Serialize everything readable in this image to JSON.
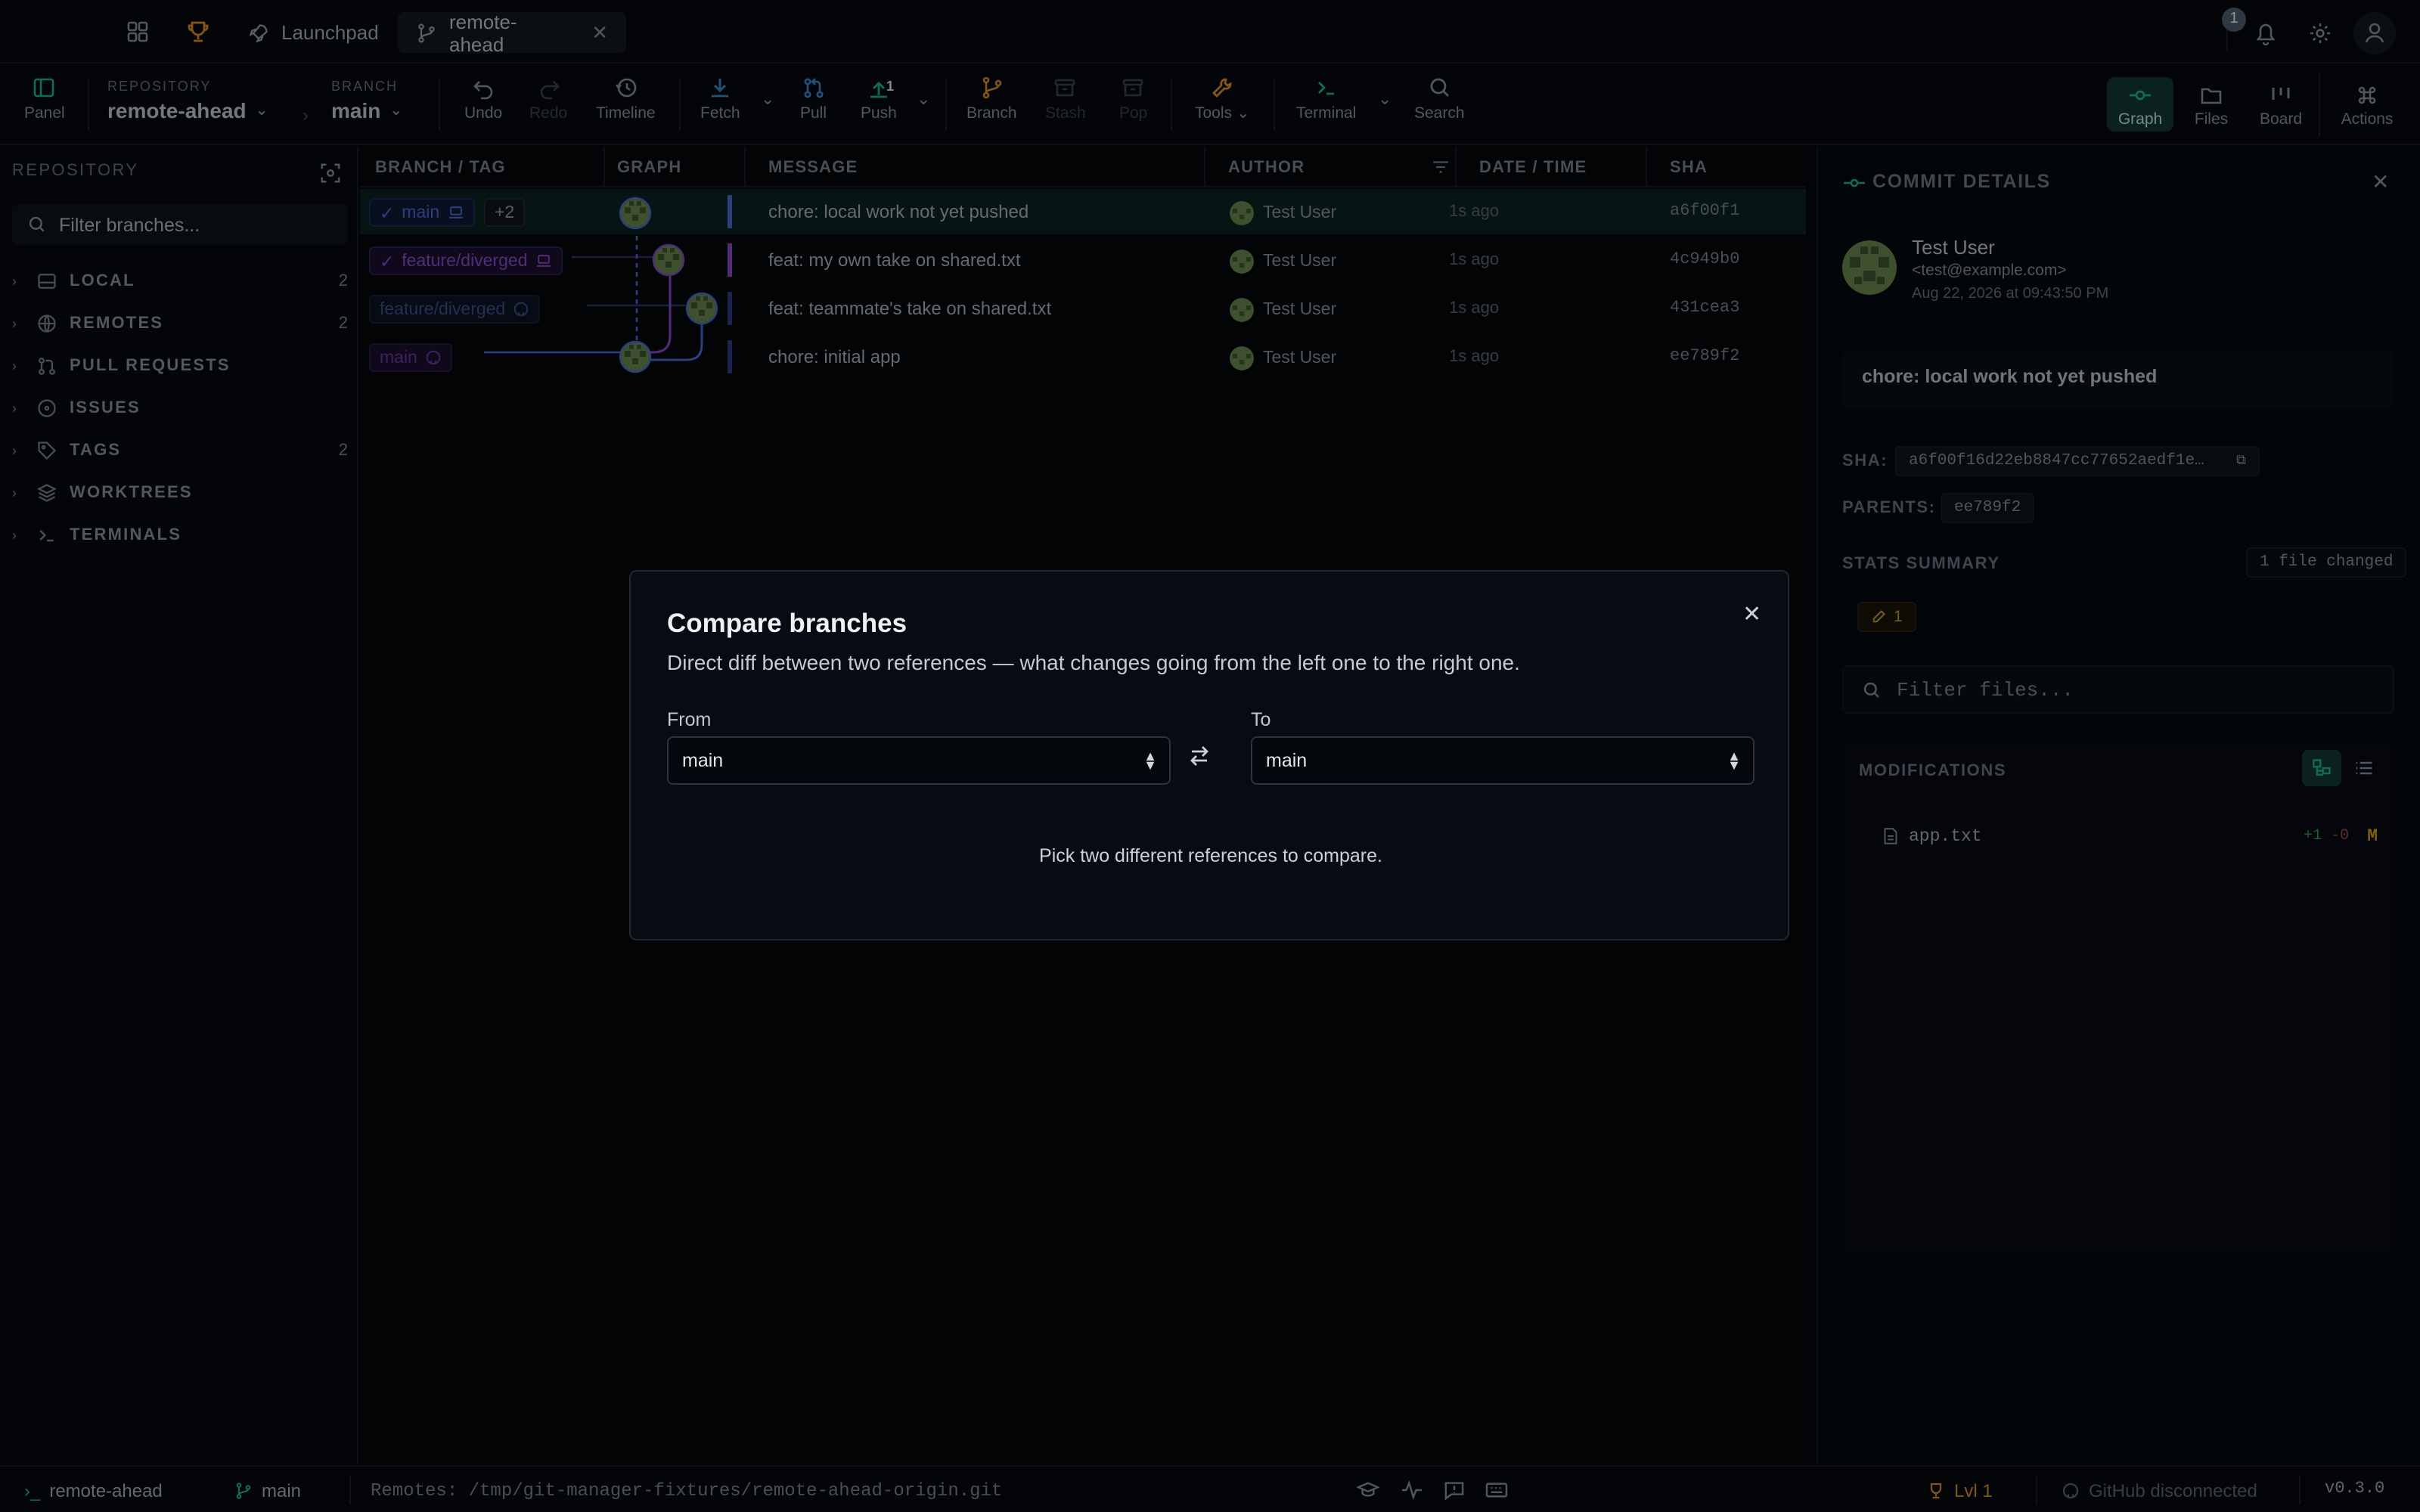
{
  "titlebar": {
    "tabs": [
      {
        "label": "Launchpad",
        "icon": "rocket-icon"
      },
      {
        "label": "remote-ahead",
        "icon": "branch-icon"
      }
    ],
    "notifications_count": "1"
  },
  "toolbar": {
    "panel_label": "Panel",
    "repository_caption": "REPOSITORY",
    "repository_value": "remote-ahead",
    "branch_caption": "BRANCH",
    "branch_value": "main",
    "undo": "Undo",
    "redo": "Redo",
    "timeline": "Timeline",
    "fetch": "Fetch",
    "pull": "Pull",
    "push": "Push",
    "push_badge": "1",
    "branch": "Branch",
    "stash": "Stash",
    "pop": "Pop",
    "tools": "Tools",
    "terminal": "Terminal",
    "search": "Search",
    "views": {
      "graph": "Graph",
      "files": "Files",
      "board": "Board",
      "actions": "Actions"
    }
  },
  "sidebar": {
    "heading": "REPOSITORY",
    "filter_placeholder": "Filter branches...",
    "sections": [
      {
        "label": "LOCAL",
        "count": "2",
        "icon": "drive-icon"
      },
      {
        "label": "REMOTES",
        "count": "2",
        "icon": "globe-icon"
      },
      {
        "label": "PULL REQUESTS",
        "count": "",
        "icon": "pull-request-icon"
      },
      {
        "label": "ISSUES",
        "count": "",
        "icon": "issue-icon"
      },
      {
        "label": "TAGS",
        "count": "2",
        "icon": "tag-icon"
      },
      {
        "label": "WORKTREES",
        "count": "",
        "icon": "layers-icon"
      },
      {
        "label": "TERMINALS",
        "count": "",
        "icon": "terminal-icon"
      }
    ]
  },
  "graph": {
    "columns": {
      "branch": "BRANCH / TAG",
      "graph": "GRAPH",
      "message": "MESSAGE",
      "author": "AUTHOR",
      "date": "DATE / TIME",
      "sha": "SHA"
    },
    "rows": [
      {
        "ref": "main",
        "ref_extra": "+2",
        "message": "chore: local work not yet pushed",
        "author": "Test User",
        "time": "1s ago",
        "sha": "a6f00f1"
      },
      {
        "ref": "feature/diverged",
        "message": "feat: my own take on shared.txt",
        "author": "Test User",
        "time": "1s ago",
        "sha": "4c949b0"
      },
      {
        "ref": "feature/diverged",
        "message": "feat: teammate's take on shared.txt",
        "author": "Test User",
        "time": "1s ago",
        "sha": "431cea3"
      },
      {
        "ref": "main",
        "message": "chore: initial app",
        "author": "Test User",
        "time": "1s ago",
        "sha": "ee789f2"
      }
    ]
  },
  "details": {
    "title": "COMMIT DETAILS",
    "author_name": "Test User",
    "author_email": "<test@example.com>",
    "date": "Aug 22, 2026 at 09:43:50 PM",
    "message": "chore: local work not yet pushed",
    "sha_label": "SHA:",
    "sha_value": "a6f00f16d22eb8847cc77652aedf1e…",
    "parents_label": "PARENTS:",
    "parent_value": "ee789f2",
    "stats_label": "STATS SUMMARY",
    "files_changed": "1 file changed",
    "modified_count": "1",
    "filter_placeholder": "Filter files...",
    "modifications_label": "MODIFICATIONS",
    "files": [
      {
        "name": "app.txt",
        "added": "+1",
        "removed": "-0",
        "status": "M"
      }
    ]
  },
  "status": {
    "repo": "remote-ahead",
    "branch": "main",
    "remotes": "Remotes: /tmp/git-manager-fixtures/remote-ahead-origin.git",
    "level": "Lvl 1",
    "github": "GitHub disconnected",
    "version": "v0.3.0"
  },
  "modal": {
    "title": "Compare branches",
    "subtitle": "Direct diff between two references — what changes going from the left one to the right one.",
    "from_label": "From",
    "from_value": "main",
    "to_label": "To",
    "to_value": "main",
    "empty_text": "Pick two different references to compare."
  },
  "colors": {
    "accent": "#1fb89a",
    "main_branch": "#4a6fd6",
    "feature_branch": "#8e4bd1",
    "level": "#e0942b",
    "modified": "#e0a21c"
  }
}
